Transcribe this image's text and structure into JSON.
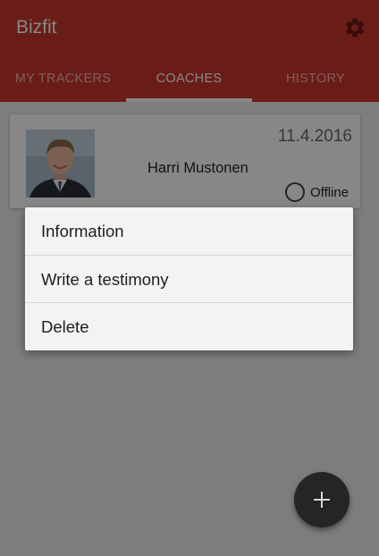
{
  "app": {
    "title": "Bizfit",
    "settings_icon": "gear-icon"
  },
  "tabs": [
    {
      "label": "MY TRACKERS",
      "active": false
    },
    {
      "label": "COACHES",
      "active": true
    },
    {
      "label": "HISTORY",
      "active": false
    }
  ],
  "coach_card": {
    "date": "11.4.2016",
    "name": "Harri Mustonen",
    "status": "Offline",
    "avatar_icon": "coach-photo"
  },
  "context_menu": {
    "items": [
      "Information",
      "Write a testimony",
      "Delete"
    ]
  },
  "fab": {
    "icon": "plus-icon"
  },
  "colors": {
    "appbar": "#c8372d",
    "fab": "#252525",
    "tab_inactive": "#f0b1ac"
  }
}
